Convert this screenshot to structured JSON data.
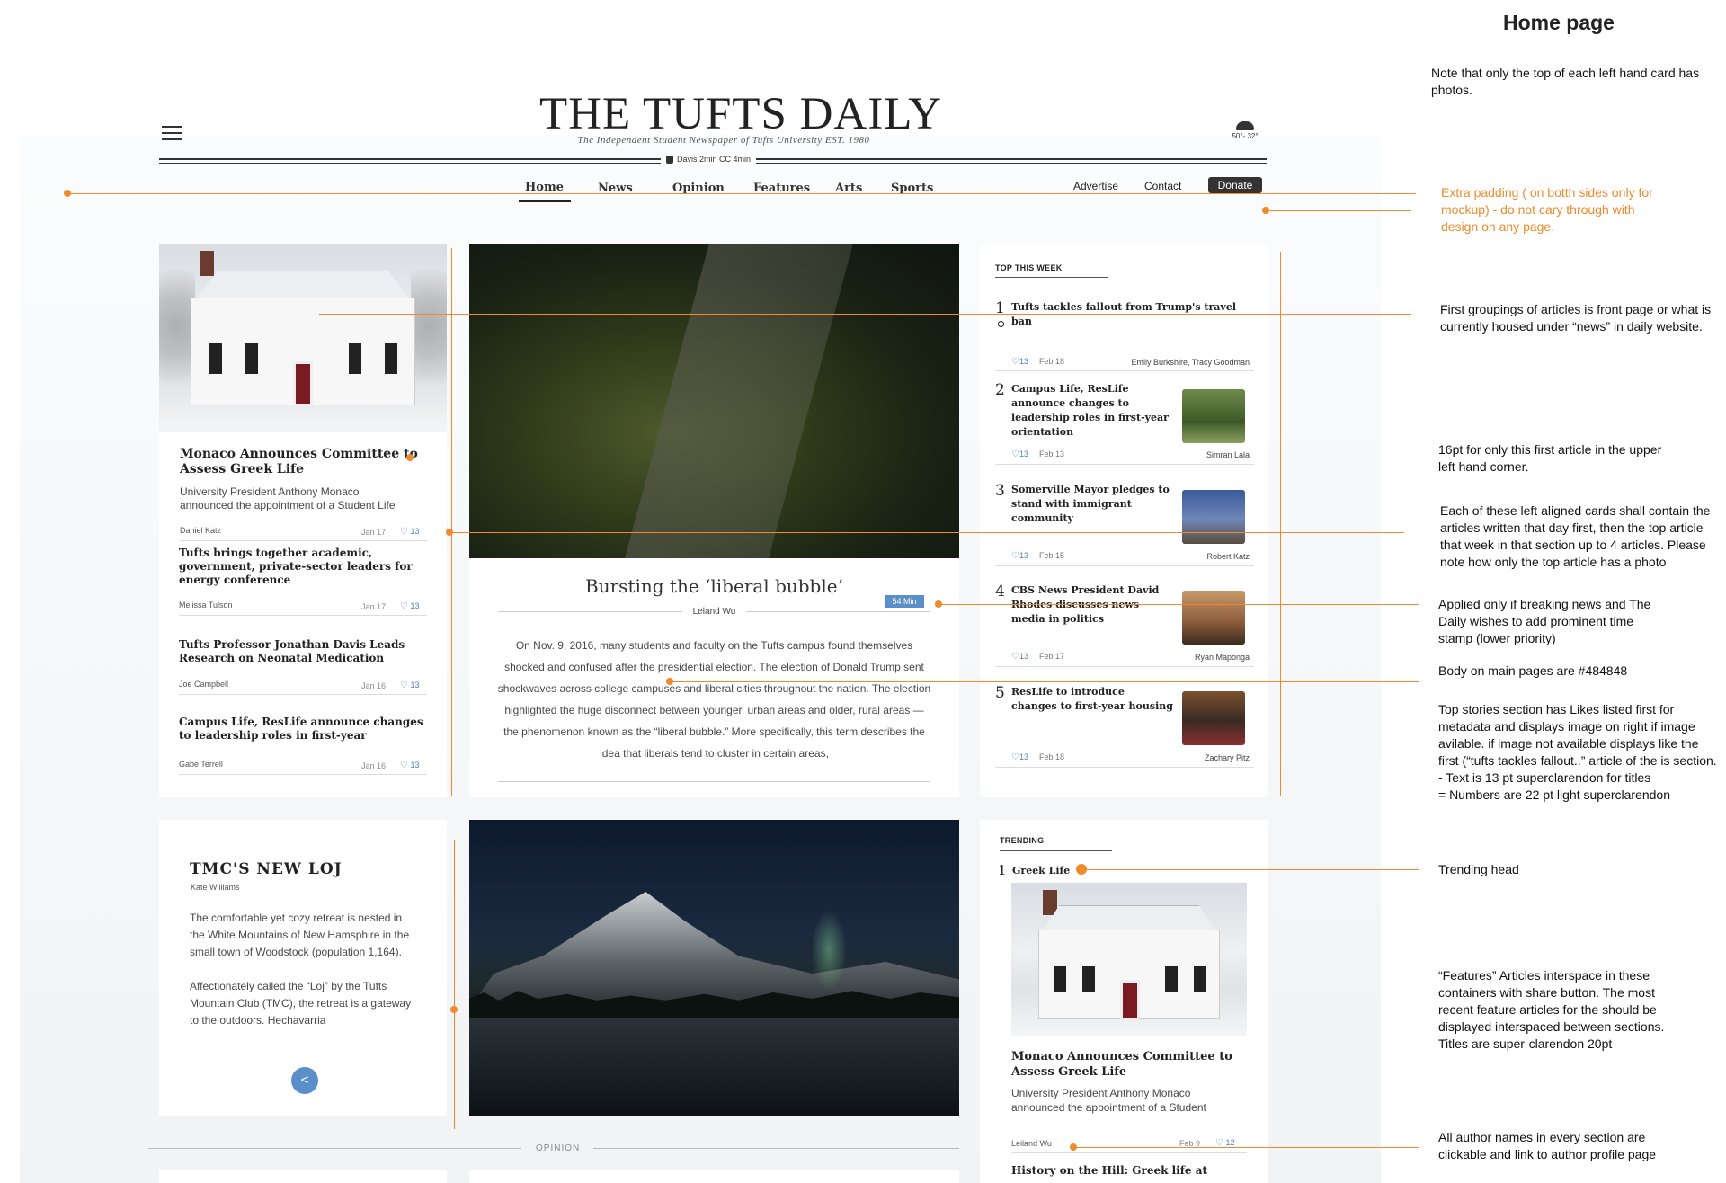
{
  "masthead": {
    "logo": "THE TUFTS DAILY",
    "tagline": "The Independent Student Newspaper of Tufts University EST. 1980",
    "transit": "Davis 2min  CC 4min",
    "weather": "50°- 32°"
  },
  "nav": {
    "items": [
      {
        "label": "Home"
      },
      {
        "label": "News"
      },
      {
        "label": "Opinion"
      },
      {
        "label": "Features"
      },
      {
        "label": "Arts"
      },
      {
        "label": "Sports"
      }
    ],
    "right": [
      {
        "label": "Advertise"
      },
      {
        "label": "Contact"
      }
    ],
    "donate": "Donate"
  },
  "left_card": {
    "lead_title": "Monaco Announces Committee to Assess Greek Life",
    "lead_excerpt": "University President Anthony Monaco announced the appointment of a Student Life",
    "lead_author": "Daniel Katz",
    "lead_date": "Jan 17",
    "lead_likes": "13",
    "articles": [
      {
        "title": "Tufts brings together academic, government, private-sector leaders for energy conference",
        "author": "Melissa Tulson",
        "date": "Jan 17",
        "likes": "13"
      },
      {
        "title": "Tufts Professor Jonathan Davis Leads Research on Neonatal Medication",
        "author": "Joe Campbell",
        "date": "Jan 16",
        "likes": "13"
      },
      {
        "title": "Campus Life, ResLife announce changes to leadership roles in first-year",
        "author": "Gabe Terrell",
        "date": "Jan 16",
        "likes": "13"
      }
    ]
  },
  "center_card": {
    "title": "Bursting the ‘liberal bubble’",
    "author": "Leland Wu",
    "read_time": "54 Min",
    "body": "On Nov. 9, 2016, many students and faculty on the Tufts campus found themselves shocked and confused after the presidential election. The election of Donald Trump sent shockwaves across college campuses and liberal cities throughout the nation. The election highlighted the huge disconnect between younger, urban areas and older, rural areas — the phenomenon known as the “liberal bubble.” More specifically, this term describes the idea that liberals tend to cluster in certain areas,"
  },
  "top_this_week": {
    "heading": "TOP THIS WEEK",
    "items": [
      {
        "num": "1",
        "title": "Tufts tackles fallout from Trump's travel ban",
        "likes": "13",
        "date": "Feb 18",
        "author": "Emily Burkshire, Tracy Goodman"
      },
      {
        "num": "2",
        "title": "Campus Life, ResLife announce changes to leadership roles in first-year orientation",
        "likes": "13",
        "date": "Feb 13",
        "author": "Simran Lala"
      },
      {
        "num": "3",
        "title": "Somerville Mayor pledges to stand with immigrant community",
        "likes": "13",
        "date": "Feb 15",
        "author": "Robert Katz"
      },
      {
        "num": "4",
        "title": "CBS News President David Rhodes discusses news media in politics",
        "likes": "13",
        "date": "Feb 17",
        "author": "Ryan Maponga"
      },
      {
        "num": "5",
        "title": "ResLife to introduce changes to first-year housing",
        "likes": "13",
        "date": "Feb 18",
        "author": "Zachary Pitz"
      }
    ]
  },
  "feature_card": {
    "title": "TMC'S NEW LOJ",
    "author": "Kate Williams",
    "para1": "The comfortable yet cozy retreat is nested in the White Mountains of New Hamsphire in the small town of Woodstock (population 1,164).",
    "para2": "Affectionately called the “Loj” by the Tufts Mountain Club (TMC), the retreat is a gateway to the outdoors. Hechavarria"
  },
  "trending": {
    "heading": "TRENDING",
    "num": "1",
    "topic": "Greek Life",
    "title": "Monaco Announces Committee to Assess Greek Life",
    "excerpt": "University President Anthony Monaco announced the appointment of a Student",
    "author": "Leiland Wu",
    "date": "Feb 9",
    "likes": "12",
    "next_title": "History on the Hill: Greek life at"
  },
  "opinion_label": "OPINION",
  "annotations": {
    "title": "Home page",
    "note_photos": "Note that only the top of each left hand card has photos.",
    "padding": "Extra padding  ( on botth sides only for mockup) - do not cary through with design on any page.",
    "first_groupings": "First groupings of articles is front page or what is currently housed under “news” in daily website.",
    "pt16": "16pt for only this first article in the upper left hand corner.",
    "left_cards": "Each of these  left aligned cards shall contain the articles written that day  first,  then the top article that week in that section up to 4 articles. Please note how only the top article has a photo",
    "breaking": "Applied only if breaking news and The Daily  wishes to add prominent time stamp (lower priority)",
    "body_color": "Body on main pages are #484848",
    "top_stories": "Top stories section has Likes listed first for metadata and displays image on right if image avilable.  if image not available displays like the first (“tufts tackles fallout..” article of the is section.\n- Text is 13 pt superclarendon for titles\n= Numbers are 22 pt light superclarendon",
    "trending_head": "Trending head",
    "features": "“Features” Articles interspace in these containers with share button. The most recent feature articles for the should be displayed interspaced between sections.  Titles are super-clarendon 20pt",
    "authors": "All author names in every section are clickable and link to author profile page"
  },
  "colors": {
    "body_text": "#484848",
    "annotation_orange": "#f08a2c",
    "accent_blue": "#5b8fc9"
  }
}
